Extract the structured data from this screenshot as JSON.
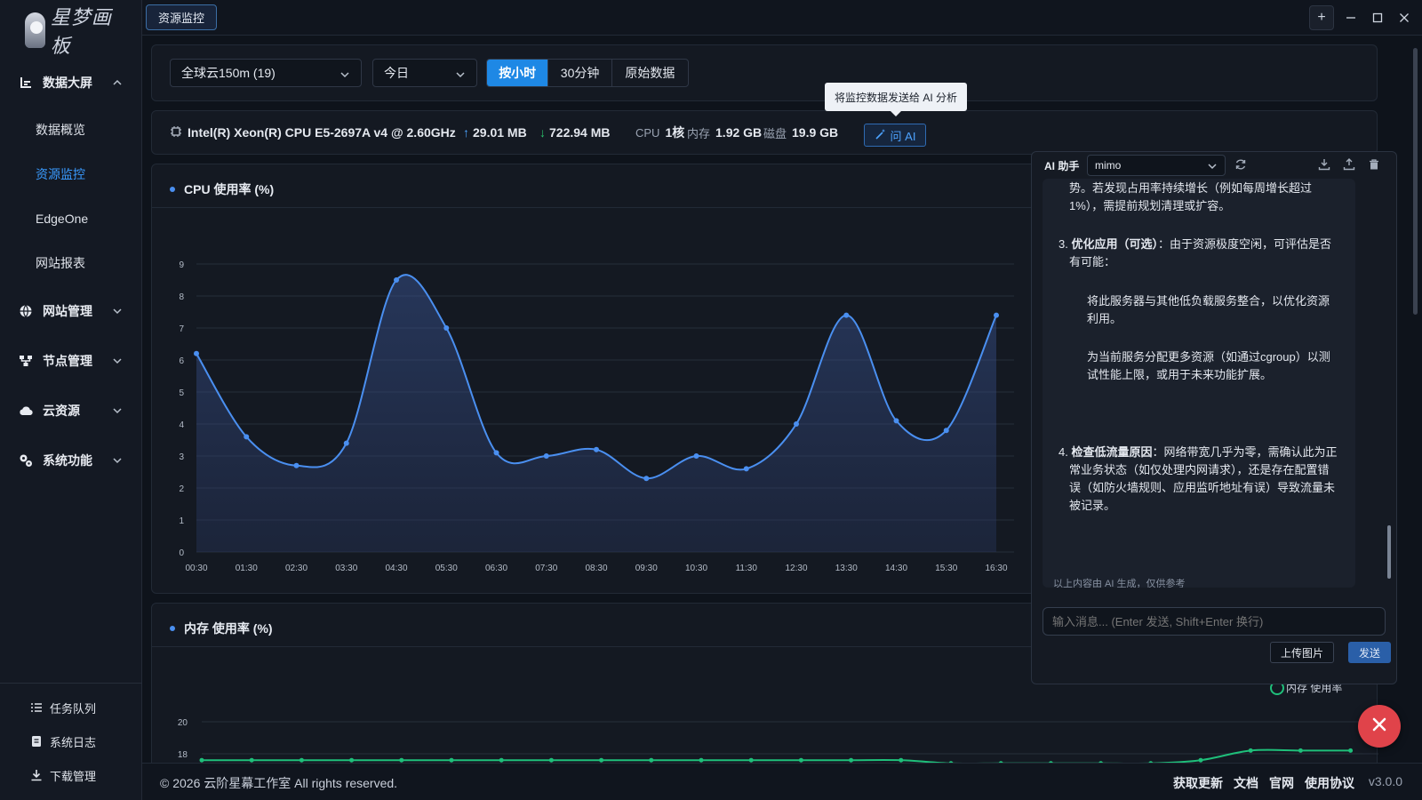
{
  "app": {
    "logo_text": "星梦画板",
    "active_tab": "资源监控",
    "version": "v3.0.0"
  },
  "sidebar": {
    "groups": [
      {
        "label": "数据大屏",
        "icon": "bar-chart-icon",
        "expanded": true
      },
      {
        "label": "网站管理",
        "icon": "globe-icon"
      },
      {
        "label": "节点管理",
        "icon": "nodes-icon"
      },
      {
        "label": "云资源",
        "icon": "cloud-icon"
      },
      {
        "label": "系统功能",
        "icon": "gears-icon"
      }
    ],
    "sub_items": [
      "数据概览",
      "资源监控",
      "EdgeOne",
      "网站报表"
    ],
    "active_sub": "资源监控",
    "footer_items": [
      {
        "label": "任务队列",
        "icon": "list-icon"
      },
      {
        "label": "系统日志",
        "icon": "log-icon"
      },
      {
        "label": "下载管理",
        "icon": "download-icon"
      }
    ]
  },
  "filters": {
    "server": "全球云150m (19)",
    "date": "今日",
    "granularity": [
      "按小时",
      "30分钟",
      "原始数据"
    ],
    "selected_granularity": "按小时"
  },
  "server_info": {
    "cpu_model": "Intel(R) Xeon(R) CPU E5-2697A v4 @ 2.60GHz",
    "upload": "29.01 MB",
    "download": "722.94 MB",
    "cpu_label": "CPU",
    "cpu_cores": "1核",
    "mem_label": "内存",
    "mem_value": "1.92 GB",
    "disk_label": "磁盘",
    "disk_value": "19.9 GB",
    "ask_ai": "问 AI",
    "tooltip": "将监控数据发送给 AI 分析"
  },
  "ai_panel": {
    "title": "AI 助手",
    "model": "mimo",
    "lines": [
      "势。若发现占用率持续增长（例如每周增长超过",
      "1%），需提前规划清理或扩容。",
      "3. ",
      "优化应用（可选）",
      "：由于资源极度空闲，可评估是否",
      "有可能：",
      "将此服务器与其他低负载服务整合，以优化资源",
      "利用。",
      "为当前服务分配更多资源（如通过cgroup）以测",
      "试性能上限，或用于未来功能扩展。",
      "4. ",
      "检查低流量原因",
      "：网络带宽几乎为零，需确认此为正",
      "常业务状态（如仅处理内网请求），还是存在配置错",
      "误（如防火墙规则、应用监听地址有误）导致流量未",
      "被记录。"
    ],
    "disclaimer": "以上内容由 AI 生成，仅供参考",
    "input_placeholder": "输入消息... (Enter 发送, Shift+Enter 换行)",
    "upload_label": "上传图片",
    "send_label": "发送"
  },
  "footer": {
    "copyright": "© 2026 云阶星幕工作室 All rights reserved.",
    "links": [
      "获取更新",
      "文档",
      "官网",
      "使用协议"
    ]
  },
  "colors": {
    "accent": "#1e88e5",
    "cpu_line": "#4a8ff0",
    "mem_line": "#1fbf7a",
    "danger": "#e0434a"
  },
  "chart_data": [
    {
      "type": "area",
      "title": "CPU 使用率 (%)",
      "x": [
        "00:30",
        "01:30",
        "02:30",
        "03:30",
        "04:30",
        "05:30",
        "06:30",
        "07:30",
        "08:30",
        "09:30",
        "10:30",
        "11:30",
        "12:30",
        "13:30",
        "14:30",
        "15:30",
        "16:30"
      ],
      "values": [
        6.2,
        3.6,
        2.7,
        3.4,
        8.5,
        7.0,
        3.1,
        3.0,
        3.2,
        2.3,
        3.0,
        2.6,
        4.0,
        7.4,
        4.1,
        3.8,
        7.4
      ],
      "ylim": [
        0,
        9
      ],
      "yticks": [
        0,
        1,
        2,
        3,
        4,
        5,
        6,
        7,
        8,
        9
      ],
      "grid": true
    },
    {
      "type": "line",
      "title": "内存 使用率 (%)",
      "legend": "内存 使用率",
      "yticks": [
        18,
        20
      ],
      "values": [
        17.6,
        17.6,
        17.6,
        17.6,
        17.6,
        17.6,
        17.6,
        17.6,
        17.6,
        17.6,
        17.6,
        17.6,
        17.6,
        17.6,
        17.6,
        17.4,
        17.4,
        17.4,
        17.4,
        17.4,
        17.6,
        18.2,
        18.2,
        18.2
      ]
    }
  ]
}
